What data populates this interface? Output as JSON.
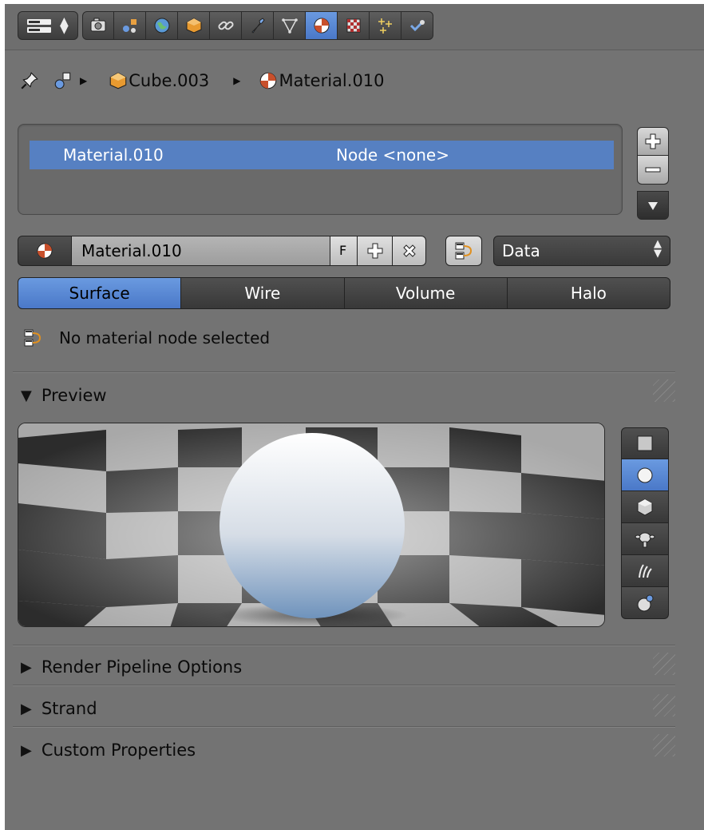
{
  "header": {
    "editor_type_icon": "properties-editor-icon",
    "tabs": [
      {
        "name": "render-icon",
        "active": false
      },
      {
        "name": "scene-icon",
        "active": false
      },
      {
        "name": "world-icon",
        "active": false
      },
      {
        "name": "object-icon",
        "active": false
      },
      {
        "name": "constraints-icon",
        "active": false
      },
      {
        "name": "modifiers-icon",
        "active": false
      },
      {
        "name": "object-data-icon",
        "active": false
      },
      {
        "name": "material-icon",
        "active": true
      },
      {
        "name": "texture-icon",
        "active": false
      },
      {
        "name": "particles-icon",
        "active": false
      },
      {
        "name": "physics-icon",
        "active": false
      }
    ]
  },
  "breadcrumb": {
    "object": "Cube.003",
    "material": "Material.010"
  },
  "slots": {
    "rows": [
      {
        "name": "Material.010",
        "node": "Node <none>"
      }
    ]
  },
  "id_block": {
    "name": "Material.010",
    "fake_user": "F",
    "link": "Data"
  },
  "type_tabs": [
    "Surface",
    "Wire",
    "Volume",
    "Halo"
  ],
  "active_type": "Surface",
  "node_status": "No material node selected",
  "panels": {
    "preview": "Preview",
    "render_pipeline": "Render Pipeline Options",
    "strand": "Strand",
    "custom_properties": "Custom Properties"
  },
  "preview": {
    "shapes": [
      "flat-icon",
      "sphere-icon",
      "cube-icon",
      "monkey-icon",
      "hair-icon",
      "sphere-with-sky-icon"
    ],
    "active_shape": "sphere-icon"
  },
  "colors": {
    "panel_bg": "#737373",
    "accent": "#5680c2",
    "text": "#0a0a0a"
  }
}
